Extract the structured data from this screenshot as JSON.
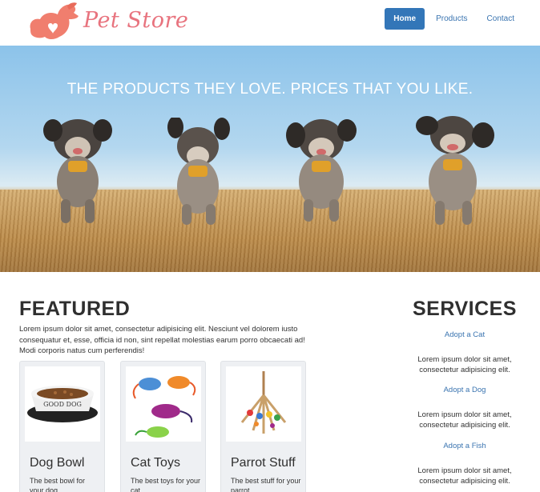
{
  "header": {
    "logo_text": "Pet Store",
    "nav": [
      {
        "label": "Home",
        "active": true
      },
      {
        "label": "Products",
        "active": false
      },
      {
        "label": "Contact",
        "active": false
      }
    ]
  },
  "hero": {
    "title": "THE PRODUCTS THEY LOVE. PRICES THAT YOU LIKE."
  },
  "featured": {
    "title": "FEATURED",
    "description": "Lorem ipsum dolor sit amet, consectetur adipisicing elit. Nesciunt vel dolorem iusto consequatur et, esse, officia id non, sint repellat molestias earum porro obcaecati ad! Modi corporis natus cum perferendis!",
    "cards": [
      {
        "title": "Dog Bowl",
        "text": "The best bowl for your dog.",
        "bowl_label": "GOOD DOG"
      },
      {
        "title": "Cat Toys",
        "text": "The best toys for your cat."
      },
      {
        "title": "Parrot Stuff",
        "text": "The best stuff for your parrot."
      }
    ]
  },
  "services": {
    "title": "SERVICES",
    "items": [
      {
        "link": "Adopt a Cat",
        "text": "Lorem ipsum dolor sit amet, consectetur adipisicing elit."
      },
      {
        "link": "Adopt a Dog",
        "text": "Lorem ipsum dolor sit amet, consectetur adipisicing elit."
      },
      {
        "link": "Adopt a Fish",
        "text": "Lorem ipsum dolor sit amet, consectetur adipisicing elit."
      }
    ]
  },
  "colors": {
    "brand": "#e8737e",
    "nav_active": "#3376b8",
    "link": "#3a74b0"
  }
}
